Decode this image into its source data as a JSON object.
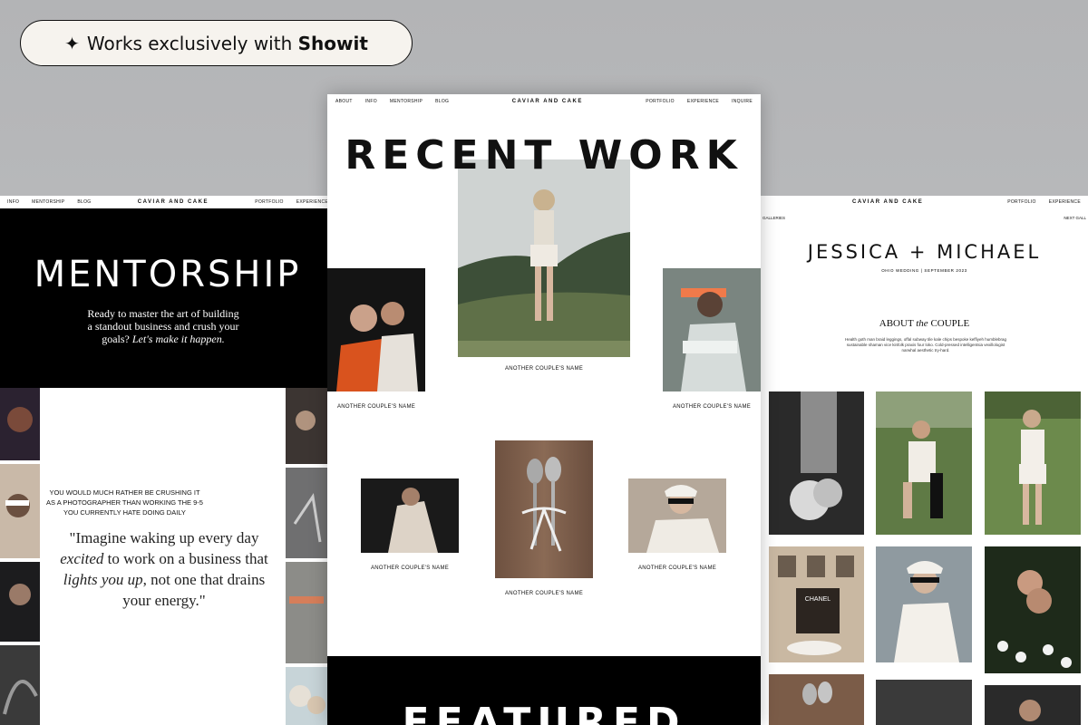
{
  "badge": {
    "star": "✦",
    "prefix": "Works exclusively with",
    "brand": "Showit"
  },
  "left": {
    "nav": {
      "items_left": [
        "INFO",
        "MENTORSHIP",
        "BLOG"
      ],
      "brand": "CAVIAR AND CAKE",
      "items_right": [
        "PORTFOLIO",
        "EXPERIENCE"
      ]
    },
    "hero_title": "MENTORSHIP",
    "hero_sub_1": "Ready to master the art of building a standout business and crush your goals?",
    "hero_sub_2": "Let's make it happen.",
    "caps": "YOU WOULD MUCH RATHER BE CRUSHING IT AS A PHOTOGRAPHER THAN WORKING THE 9-5 YOU CURRENTLY HATE DOING DAILY",
    "quote_1": "\"Imagine waking up every day",
    "quote_2": "excited",
    "quote_3": "to work on a business that",
    "quote_4": "lights you up",
    "quote_5": ", not one that drains your energy.\""
  },
  "middle": {
    "nav": {
      "items_left": [
        "ABOUT",
        "INFO",
        "MENTORSHIP",
        "BLOG"
      ],
      "brand": "CAVIAR AND CAKE",
      "items_right": [
        "PORTFOLIO",
        "EXPERIENCE",
        "INQUIRE"
      ]
    },
    "title": "RECENT WORK",
    "captions": [
      "ANOTHER COUPLE'S NAME",
      "ANOTHER COUPLE'S NAME",
      "ANOTHER COUPLE'S NAME",
      "ANOTHER COUPLE'S NAME",
      "ANOTHER COUPLE'S NAME",
      "ANOTHER COUPLE'S NAME"
    ],
    "featured": "FEATURED"
  },
  "right": {
    "nav": {
      "brand": "CAVIAR AND CAKE",
      "items_right": [
        "PORTFOLIO",
        "EXPERIENCE"
      ]
    },
    "galleries_label": "GALLERIES",
    "next_label": "NEXT GALL",
    "title": "JESSICA + MICHAEL",
    "sub": "OHIO WEDDING | SEPTEMBER 2023",
    "about_1": "ABOUT",
    "about_2": "the",
    "about_3": "COUPLE",
    "about_body": "Health goth man braid leggings, offal subway tile kale chips bespoke keffiyeh humblebrag sustainable shaman vice kinfolk praxis four loko. Cold-pressed intelligentsia vexillologist narwhal aesthetic try-hard.",
    "storefront_sign": "CHANEL"
  }
}
